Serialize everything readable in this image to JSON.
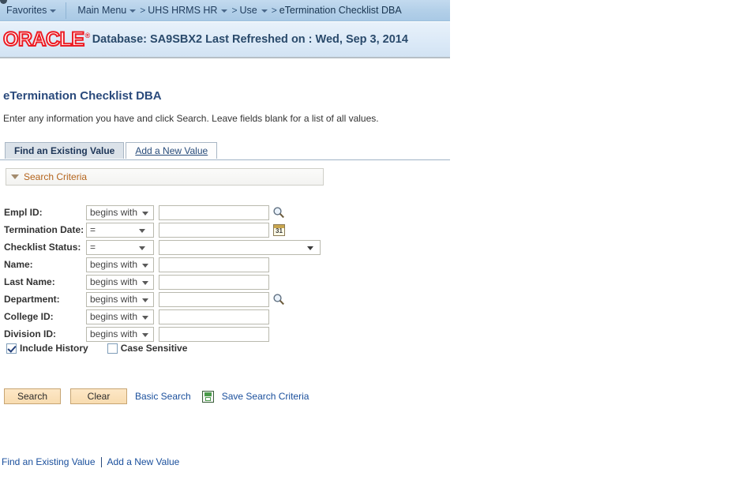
{
  "navbar": {
    "favorites": "Favorites",
    "main_menu": "Main Menu",
    "breadcrumbs": [
      {
        "label": "UHS HRMS HR",
        "has_caret": true
      },
      {
        "label": "Use",
        "has_caret": true
      },
      {
        "label": "eTermination Checklist DBA",
        "has_caret": false
      }
    ],
    "separator": ">"
  },
  "oracle_band": {
    "logo": "ORACLE",
    "trademark": "®",
    "database_text": "Database: SA9SBX2 Last Refreshed on : Wed, Sep 3, 2014",
    "logo_color": "#ec1c24",
    "text_color": "#2a4a6b"
  },
  "page": {
    "title": "eTermination Checklist DBA",
    "instructions": "Enter any information you have and click Search. Leave fields blank for a list of all values."
  },
  "tabs": [
    {
      "label": "Find an Existing Value",
      "active": true
    },
    {
      "label": "Add a New Value",
      "active": false
    }
  ],
  "search_criteria": {
    "header_label": "Search Criteria",
    "header_color": "#b5651d",
    "expanded": true
  },
  "fields": [
    {
      "label": "Empl ID:",
      "operator": "begins with",
      "operator_type": "text",
      "value": "",
      "control": "text",
      "icon": "lookup-icon"
    },
    {
      "label": "Termination Date:",
      "operator": "=",
      "operator_type": "date",
      "value": "",
      "control": "text",
      "icon": "calendar-icon",
      "calendar_glyph": "31"
    },
    {
      "label": "Checklist Status:",
      "operator": "=",
      "operator_type": "date",
      "value": "",
      "control": "select",
      "icon": ""
    },
    {
      "label": "Name:",
      "operator": "begins with",
      "operator_type": "text",
      "value": "",
      "control": "text",
      "icon": ""
    },
    {
      "label": "Last Name:",
      "operator": "begins with",
      "operator_type": "text",
      "value": "",
      "control": "text",
      "icon": ""
    },
    {
      "label": "Department:",
      "operator": "begins with",
      "operator_type": "text",
      "value": "",
      "control": "text",
      "icon": "lookup-icon"
    },
    {
      "label": "College ID:",
      "operator": "begins with",
      "operator_type": "text",
      "value": "",
      "control": "text",
      "icon": ""
    },
    {
      "label": "Division ID:",
      "operator": "begins with",
      "operator_type": "text",
      "value": "",
      "control": "text",
      "icon": ""
    }
  ],
  "checkboxes": [
    {
      "label": "Include History",
      "checked": true
    },
    {
      "label": "Case Sensitive",
      "checked": false
    }
  ],
  "actions": {
    "search_label": "Search",
    "clear_label": "Clear",
    "basic_search_label": "Basic Search",
    "save_search_label": "Save Search Criteria",
    "save_icon": "save-disk-icon"
  },
  "footer": {
    "find_existing_label": "Find an Existing Value",
    "separator": "|",
    "add_new_label": "Add a New Value"
  }
}
